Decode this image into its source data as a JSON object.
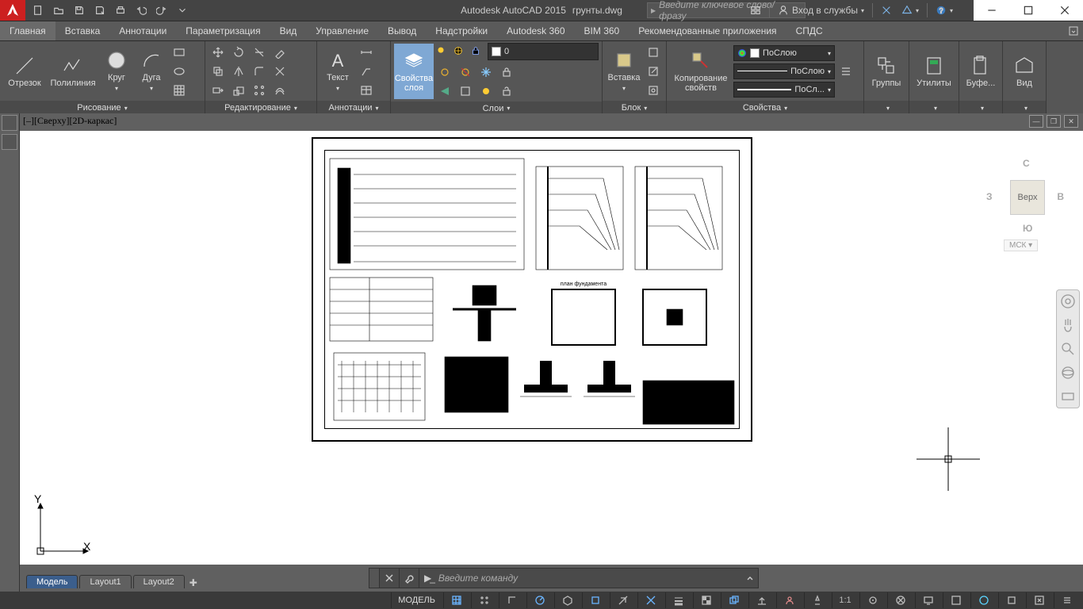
{
  "app": {
    "title": "Autodesk AutoCAD 2015",
    "file": "грунты.dwg"
  },
  "search": {
    "placeholder": "Введите ключевое слово/фразу"
  },
  "account": {
    "label": "Вход в службы"
  },
  "ribbon_tabs": [
    "Главная",
    "Вставка",
    "Аннотации",
    "Параметризация",
    "Вид",
    "Управление",
    "Вывод",
    "Надстройки",
    "Autodesk 360",
    "BIM 360",
    "Рекомендованные приложения",
    "СПДС"
  ],
  "ribbon_active": 0,
  "panels": {
    "draw": {
      "title": "Рисование",
      "line": "Отрезок",
      "polyline": "Полилиния",
      "circle": "Круг",
      "arc": "Дуга"
    },
    "modify": {
      "title": "Редактирование"
    },
    "annotation": {
      "title": "Аннотации",
      "text": "Текст"
    },
    "layers": {
      "title": "Слои",
      "props": "Свойства\nслоя",
      "current": "0"
    },
    "block": {
      "title": "Блок",
      "insert": "Вставка"
    },
    "properties": {
      "title": "Свойства",
      "color": "ПоСлою",
      "ltype": "ПоСлою",
      "lweight": "ПоСл...",
      "match": "Копирование\nсвойств"
    },
    "groups": {
      "title": "Группы"
    },
    "utilities": {
      "title": "Утилиты"
    },
    "clipboard": {
      "title": "Буфе..."
    },
    "view": {
      "title": "Вид"
    }
  },
  "viewport": {
    "label": "[–][Сверху][2D-каркас]"
  },
  "viewcube": {
    "face": "Верх",
    "n": "С",
    "s": "Ю",
    "e": "В",
    "w": "З",
    "wcs": "МСК"
  },
  "axis": {
    "x": "X",
    "y": "Y"
  },
  "command": {
    "placeholder": "Введите  команду"
  },
  "layout_tabs": {
    "model": "Модель",
    "l1": "Layout1",
    "l2": "Layout2"
  },
  "status": {
    "model": "МОДЕЛЬ",
    "scale": "1:1"
  }
}
